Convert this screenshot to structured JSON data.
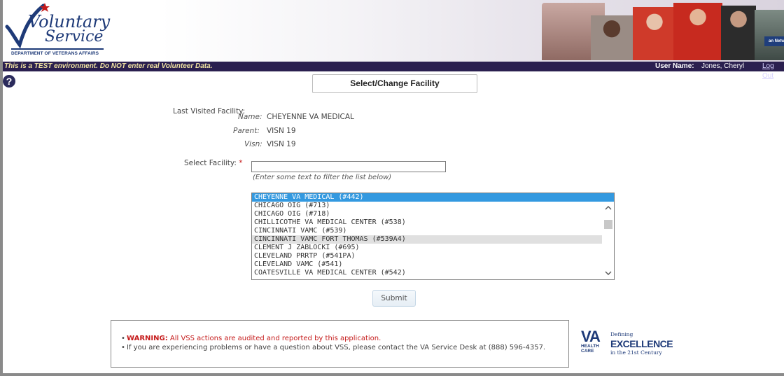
{
  "header": {
    "logo_line1": "Voluntary",
    "logo_line2": "Service",
    "logo_dept": "DEPARTMENT OF VETERANS AFFAIRS",
    "photo_tag": "an Netw"
  },
  "infobar": {
    "test_message": "This is a TEST environment. Do NOT enter real Volunteer Data.",
    "user_label": "User Name:",
    "user_name": "Jones, Cheryl",
    "logout": "Log Out"
  },
  "help": {
    "symbol": "?"
  },
  "page": {
    "title": "Select/Change Facility"
  },
  "last_visited": {
    "label": "Last Visited Facility:",
    "name_label": "Name:",
    "name_value": "CHEYENNE VA MEDICAL",
    "parent_label": "Parent:",
    "parent_value": "VISN 19",
    "visn_label": "Visn:",
    "visn_value": "VISN 19"
  },
  "select_facility": {
    "label": "Select Facility:",
    "required_marker": "*",
    "input_value": "",
    "hint": "(Enter some text to filter the list below)"
  },
  "facility_list": {
    "options": [
      "CHEYENNE VA MEDICAL (#442)",
      "CHICAGO OIG (#713)",
      "CHICAGO OIG (#718)",
      "CHILLICOTHE VA MEDICAL CENTER (#538)",
      "CINCINNATI VAMC (#539)",
      "CINCINNATI VAMC FORT THOMAS (#539A4)",
      "CLEMENT J ZABLOCKI (#695)",
      "CLEVELAND PRRTP (#541PA)",
      "CLEVELAND VAMC (#541)",
      "COATESVILLE VA MEDICAL CENTER (#542)"
    ],
    "selected_index": 0,
    "hover_index": 5
  },
  "actions": {
    "submit_label": "Submit"
  },
  "notice": {
    "warning_label": "WARNING:",
    "warning_text": " All VSS actions are audited and reported by this application.",
    "contact_text": "If you are experiencing problems or have a question about VSS, please contact the VA Service Desk at (888) 596-4357."
  },
  "va_logo": {
    "va": "VA",
    "health": "HEALTH",
    "care": "CARE",
    "defining": "Defining",
    "excellence": "EXCELLENCE",
    "century": "in the 21st Century"
  },
  "colors": {
    "brand_navy": "#1e3a78",
    "infobar_bg": "#2a1f4f",
    "selected_option": "#3399e0",
    "warning_red": "#c51b1b"
  }
}
